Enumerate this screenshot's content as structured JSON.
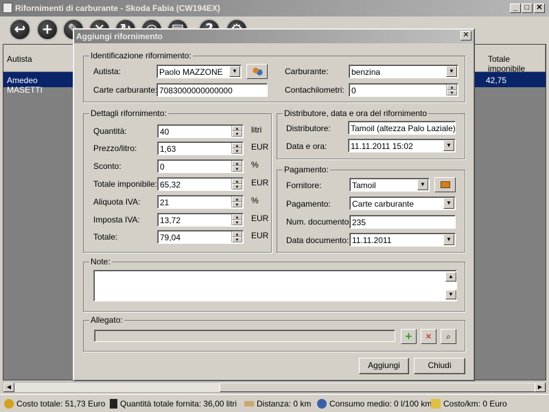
{
  "window": {
    "title": "Rifornimenti di carburante - Skoda Fabia (CW194EX)",
    "min": "_",
    "max": "□",
    "close": "✕"
  },
  "toolbar": {
    "icons": [
      "exit-icon",
      "add-icon",
      "edit-icon",
      "delete-icon",
      "refresh-icon",
      "print-icon",
      "report-icon",
      "help-icon",
      "settings-icon"
    ]
  },
  "grid": {
    "headers": {
      "autista": "Autista",
      "totale_imponibile": "Totale imponibile"
    },
    "row": {
      "autista": "Amedeo MASETTI",
      "totale_imponibile": "42,75"
    }
  },
  "status": {
    "costo_totale": "Costo totale: 51,73 Euro",
    "quantita": "Quantità totale fornita: 36,00 litri",
    "distanza": "Distanza: 0 km",
    "consumo": "Consumo medio: 0 l/100 km",
    "costo_km": "Costo/km: 0 Euro"
  },
  "dialog": {
    "title": "Aggiungi rifornimento",
    "close": "✕",
    "ident": {
      "legend": "Identificazione rifornimento:",
      "autista_label": "Autista:",
      "autista_value": "Paolo MAZZONE",
      "carte_label": "Carte carburante:",
      "carte_value": "7083000000000000",
      "carburante_label": "Carburante:",
      "carburante_value": "benzina",
      "contachilometri_label": "Contachilometri:",
      "contachilometri_value": "0"
    },
    "dettagli": {
      "legend": "Dettagli rifornimento:",
      "rows": [
        {
          "label": "Quantità:",
          "value": "40",
          "unit": "litri"
        },
        {
          "label": "Prezzo/litro:",
          "value": "1,63",
          "unit": "EUR"
        },
        {
          "label": "Sconto:",
          "value": "0",
          "unit": "%"
        },
        {
          "label": "Totale imponibile:",
          "value": "65,32",
          "unit": "EUR"
        },
        {
          "label": "Aliquota IVA:",
          "value": "21",
          "unit": "%"
        },
        {
          "label": "Imposta IVA:",
          "value": "13,72",
          "unit": "EUR"
        },
        {
          "label": "Totale:",
          "value": "79,04",
          "unit": "EUR"
        }
      ]
    },
    "distributore": {
      "legend": "Distributore, data e ora del rifornimento",
      "distributore_label": "Distributore:",
      "distributore_value": "Tamoil (altezza Palo Laziale)",
      "data_label": "Data e ora:",
      "data_value": "11.11.2011 15:02"
    },
    "pagamento": {
      "legend": "Pagamento:",
      "fornitore_label": "Fornitore:",
      "fornitore_value": "Tamoil",
      "pagamento_label": "Pagamento:",
      "pagamento_value": "Carte carburante",
      "numdoc_label": "Num. documento:",
      "numdoc_value": "235",
      "datadoc_label": "Data documento:",
      "datadoc_value": "11.11.2011"
    },
    "note": {
      "legend": "Note:",
      "value": ""
    },
    "allegato": {
      "legend": "Allegato:",
      "value": ""
    },
    "buttons": {
      "aggiungi": "Aggiungi",
      "chiudi": "Chiudi"
    }
  }
}
